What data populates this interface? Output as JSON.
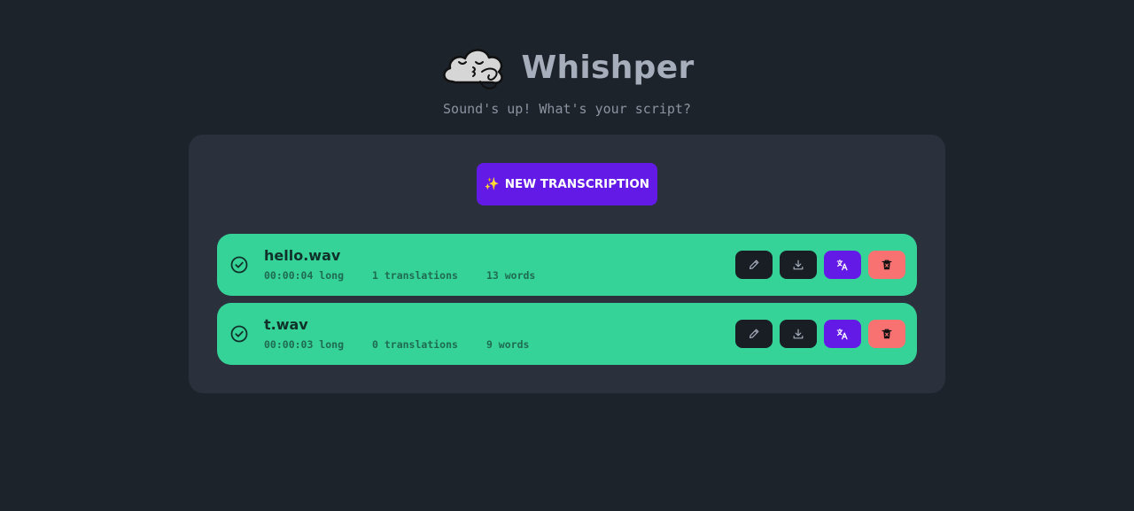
{
  "app": {
    "title": "Whishper",
    "subtitle": "Sound's up! What's your script?",
    "logo_icon": "cloud-face-icon"
  },
  "toolbar": {
    "new_transcription_icon": "✨",
    "new_transcription_label": "NEW TRANSCRIPTION"
  },
  "colors": {
    "background": "#1d232a",
    "panel": "#2a303c",
    "success": "#36d399",
    "primary": "#641ae6",
    "error": "#f87272",
    "dark_button": "#191e24"
  },
  "transcriptions": [
    {
      "status_icon": "check-circle-icon",
      "filename": "hello.wav",
      "duration": "00:00:04 long",
      "translations": "1 translations",
      "words": "13 words",
      "actions": [
        "edit-icon",
        "download-icon",
        "translate-icon",
        "trash-icon"
      ]
    },
    {
      "status_icon": "check-circle-icon",
      "filename": "t.wav",
      "duration": "00:00:03 long",
      "translations": "0 translations",
      "words": "9 words",
      "actions": [
        "edit-icon",
        "download-icon",
        "translate-icon",
        "trash-icon"
      ]
    }
  ]
}
